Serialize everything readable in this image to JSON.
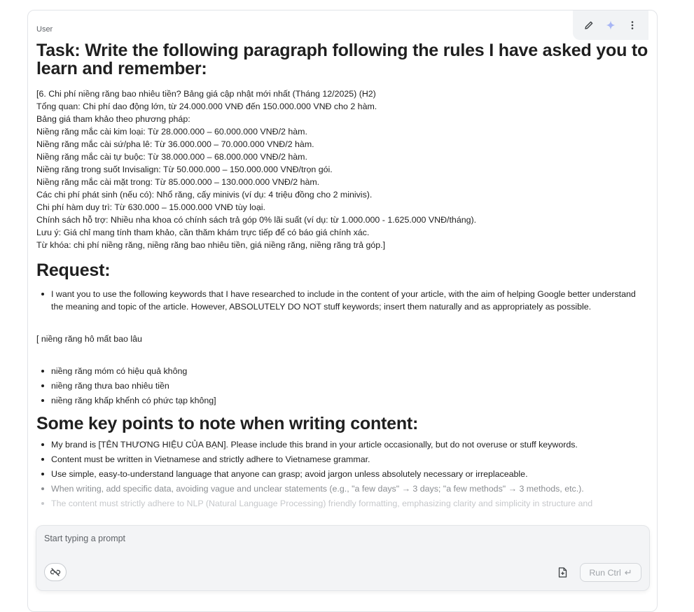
{
  "message": {
    "role": "User",
    "heading": "Task: Write the following paragraph following the rules I have asked you to learn and remember:",
    "paragraph_lines": [
      "[6. Chi phí niềng răng bao nhiêu tiền? Bảng giá cập nhật mới nhất (Tháng 12/2025) (H2)",
      "Tổng quan: Chi phí dao động lớn, từ 24.000.000 VNĐ đến 150.000.000 VNĐ cho 2 hàm.",
      "Bảng giá tham khảo theo phương pháp:",
      "Niềng răng mắc cài kim loại: Từ 28.000.000 – 60.000.000 VNĐ/2 hàm.",
      "Niềng răng mắc cài sứ/pha lê: Từ 36.000.000 – 70.000.000 VNĐ/2 hàm.",
      "Niềng răng mắc cài tự buộc: Từ 38.000.000 – 68.000.000 VNĐ/2 hàm.",
      "Niềng răng trong suốt Invisalign: Từ 50.000.000 – 150.000.000 VNĐ/trọn gói.",
      "Niềng răng mắc cài mặt trong: Từ 85.000.000 – 130.000.000 VNĐ/2 hàm.",
      "Các chi phí phát sinh (nếu có): Nhổ răng, cấy minivis (ví dụ: 4 triệu đồng cho 2 minivis).",
      "Chi phí hàm duy trì: Từ 630.000 – 15.000.000 VNĐ tùy loại.",
      "Chính sách hỗ trợ: Nhiều nha khoa có chính sách trả góp 0% lãi suất (ví dụ: từ 1.000.000 - 1.625.000 VNĐ/tháng).",
      "Lưu ý: Giá chỉ mang tính tham khảo, cần thăm khám trực tiếp để có báo giá chính xác.",
      "Từ khóa: chi phí niềng răng, niềng răng bao nhiêu tiền, giá niềng răng, niềng răng trả góp.]"
    ],
    "request_heading": "Request:",
    "request_bullets": [
      "I want you to use the following keywords that I have researched to include in the content of your article, with the aim of helping Google better understand the meaning and topic of the article. However, ABSOLUTELY DO NOT stuff keywords; insert them naturally and as appropriately as possible."
    ],
    "keyword_intro": "[  niềng răng hô mất bao lâu",
    "keyword_bullets": [
      "niềng răng móm có hiệu quả không",
      "niềng răng thưa bao nhiêu tiền",
      "niềng răng khấp khểnh có phức tạp không]"
    ],
    "notes_heading": "Some key points to note when writing content:",
    "notes_bullets": [
      "My brand is [TÊN THƯƠNG HIỆU CỦA BẠN]. Please include this brand in your article occasionally, but do not overuse or stuff keywords.",
      "Content must be written in Vietnamese and strictly adhere to Vietnamese grammar.",
      "Use simple, easy-to-understand language that anyone can grasp; avoid jargon unless absolutely necessary or irreplaceable.",
      "When writing, add specific data, avoiding vague and unclear statements (e.g., \"a few days\" → 3 days; \"a few methods\" → 3 methods, etc.).",
      "The content must strictly adhere to NLP (Natural Language Processing) friendly formatting, emphasizing clarity and simplicity in structure and"
    ]
  },
  "toolbar": {
    "icons": [
      "pencil-icon",
      "sparkle-icon",
      "more-vert-icon"
    ]
  },
  "prompt": {
    "placeholder": "Start typing a prompt",
    "run_label": "Run Ctrl",
    "run_glyph": "↵"
  },
  "colors": {
    "sparkle": "#a8b6f5",
    "text": "#1f1f1f",
    "muted": "#5f6368"
  }
}
